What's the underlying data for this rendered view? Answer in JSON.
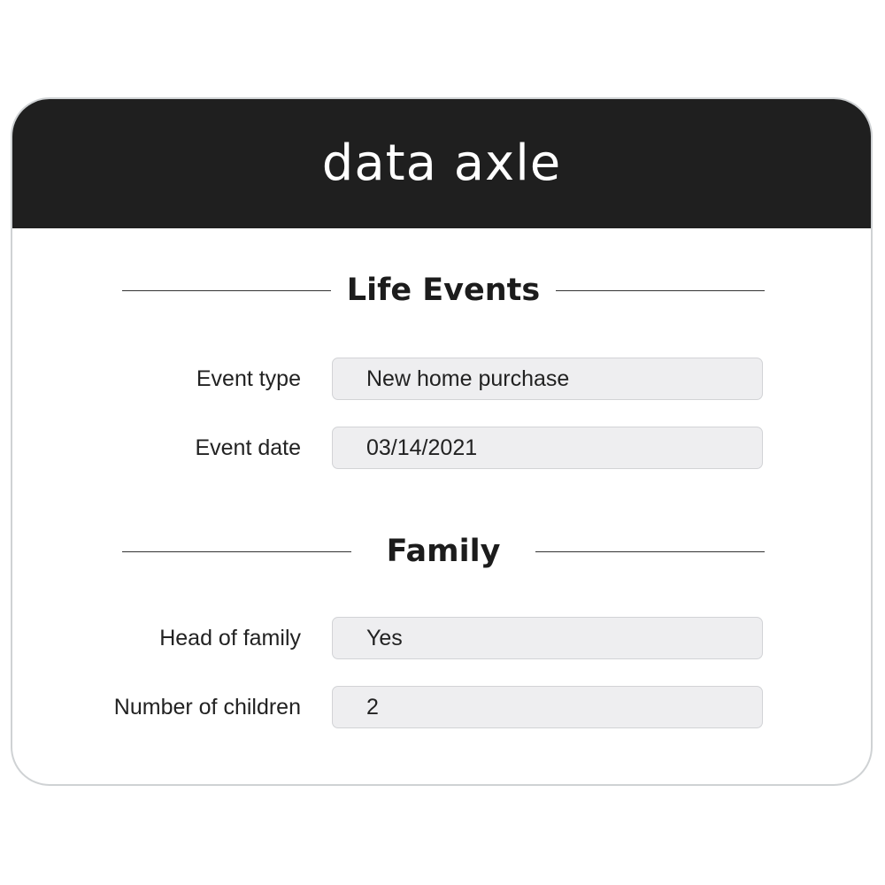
{
  "header": {
    "logo_text": "data axle",
    "background": "#1f1f1f"
  },
  "sections": [
    {
      "title": "Life Events",
      "fields": [
        {
          "label": "Event type",
          "value": "New home purchase"
        },
        {
          "label": "Event date",
          "value": "03/14/2021"
        }
      ]
    },
    {
      "title": "Family",
      "fields": [
        {
          "label": "Head of family",
          "value": "Yes"
        },
        {
          "label": "Number of children",
          "value": "2"
        }
      ]
    }
  ],
  "colors": {
    "field_background": "#eeeef0",
    "field_border": "#d2d3d6",
    "text": "#222222"
  }
}
